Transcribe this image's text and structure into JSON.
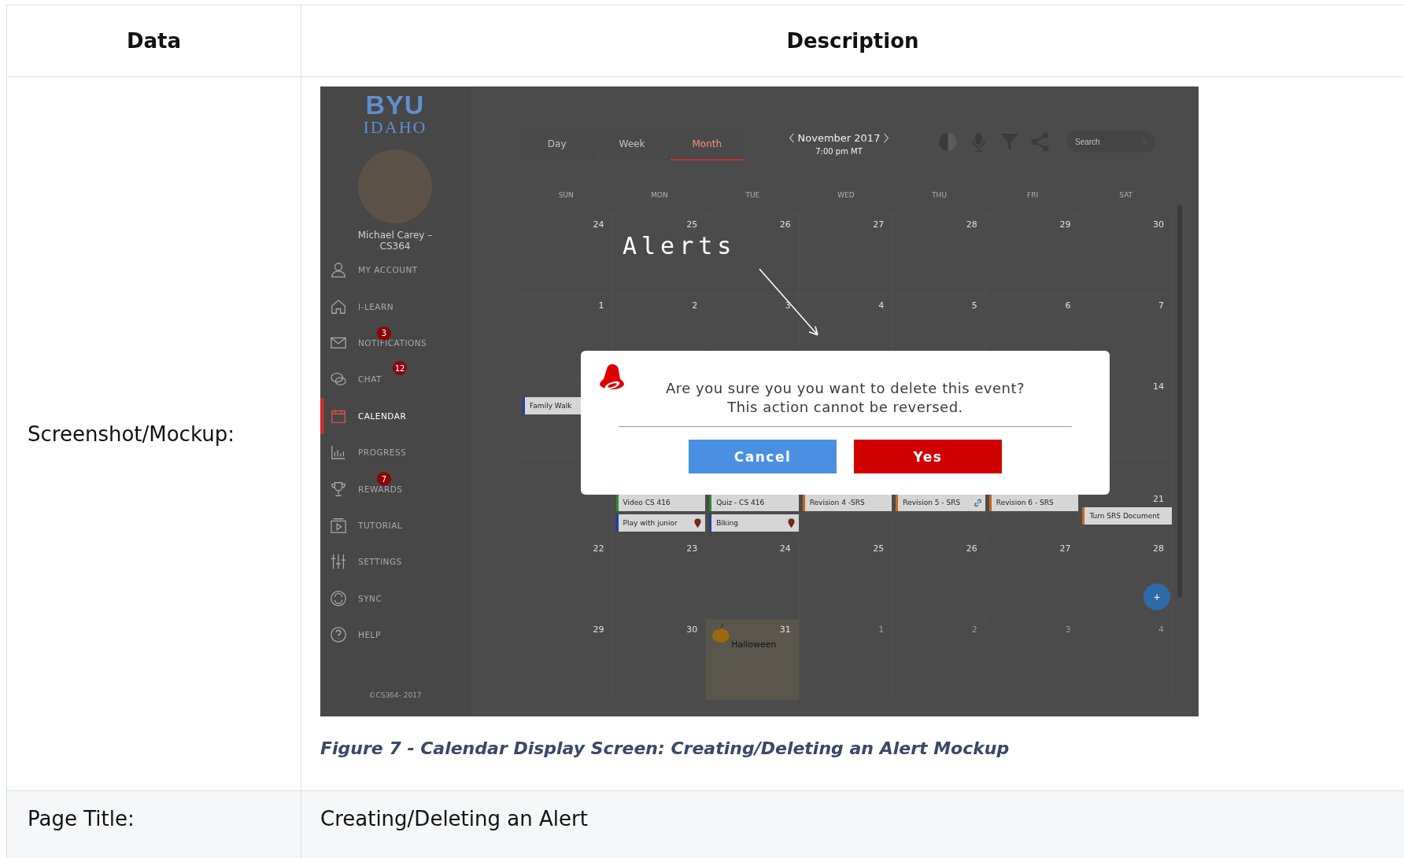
{
  "table": {
    "columns": [
      "Data",
      "Description"
    ],
    "mockup_row": {
      "label": "Screenshot/Mockup:",
      "caption": "Figure 7 - Calendar Display Screen: Creating/Deleting an Alert Mockup",
      "mockup": {
        "logo": {
          "line1": "BYU",
          "line2": "IDAHO"
        },
        "user_name": "Michael Carey – CS364",
        "nav": [
          {
            "kind": "account",
            "label": "MY ACCOUNT",
            "selected": false
          },
          {
            "kind": "home",
            "label": "I-LEARN",
            "selected": false
          },
          {
            "kind": "mail",
            "label": "NOTIFICATIONS",
            "selected": false,
            "badge": "3"
          },
          {
            "kind": "chat",
            "label": "CHAT",
            "selected": false,
            "badge": "12"
          },
          {
            "kind": "calendar",
            "label": "CALENDAR",
            "selected": true
          },
          {
            "kind": "chart",
            "label": "PROGRESS",
            "selected": false
          },
          {
            "kind": "trophy",
            "label": "REWARDS",
            "selected": false,
            "badge": "7"
          },
          {
            "kind": "play",
            "label": "TUTORIAL",
            "selected": false
          },
          {
            "kind": "sliders",
            "label": "SETTINGS",
            "selected": false
          },
          {
            "kind": "sync",
            "label": "SYNC",
            "selected": false
          },
          {
            "kind": "help",
            "label": "HELP",
            "selected": false
          }
        ],
        "footer": "©CS364- 2017",
        "view_tabs": [
          {
            "label": "Day",
            "selected": false
          },
          {
            "label": "Week",
            "selected": false
          },
          {
            "label": "Month",
            "selected": true
          }
        ],
        "month": "November 2017",
        "time": "7:00 pm MT",
        "search": {
          "placeholder": "Search"
        },
        "weekdays": [
          "SUN",
          "MON",
          "TUE",
          "WED",
          "THU",
          "FRI",
          "SAT"
        ],
        "weeks": [
          {
            "sun": {
              "day": "24"
            },
            "mon": {
              "day": "25"
            },
            "tue": {
              "day": "26"
            },
            "wed": {
              "day": "27"
            },
            "thu": {
              "day": "28"
            },
            "fri": {
              "day": "29"
            },
            "sat": {
              "day": "30"
            }
          },
          {
            "sun": {
              "day": "1"
            },
            "mon": {
              "day": "2"
            },
            "tue": {
              "day": "3"
            },
            "wed": {
              "day": "4"
            },
            "thu": {
              "day": "5"
            },
            "fri": {
              "day": "6"
            },
            "sat": {
              "day": "7"
            }
          },
          {
            "sun": {
              "events": [
                {
                  "title": "Family Walk",
                  "color": "#1f3f9e"
                }
              ]
            },
            "sat": {
              "day": "14"
            }
          },
          {
            "mon": {
              "events": [
                {
                  "title": "Video CS 416",
                  "color": "#2e8b2e"
                },
                {
                  "title": "Play with junior",
                  "color": "#1f3f9e",
                  "pin": true
                }
              ]
            },
            "tue": {
              "events": [
                {
                  "title": "Quiz - CS 416",
                  "color": "#2e8b2e"
                },
                {
                  "title": "Biking",
                  "color": "#1f3f9e",
                  "pin": true
                }
              ]
            },
            "wed": {
              "events": [
                {
                  "title": "Revision 4 -SRS",
                  "color": "#c8651d"
                }
              ]
            },
            "thu": {
              "events": [
                {
                  "title": "Revision 5 - SRS",
                  "color": "#c8651d",
                  "link": true
                }
              ]
            },
            "fri": {
              "events": [
                {
                  "title": "Revision 6 - SRS",
                  "color": "#c8651d"
                }
              ]
            },
            "sat": {
              "day": "21",
              "events": [
                {
                  "title": "Turn SRS Document",
                  "color": "#c8651d"
                }
              ]
            }
          },
          {
            "sun": {
              "day": "22"
            },
            "mon": {
              "day": "23"
            },
            "tue": {
              "day": "24"
            },
            "wed": {
              "day": "25"
            },
            "thu": {
              "day": "26"
            },
            "fri": {
              "day": "27"
            },
            "sat": {
              "day": "28"
            }
          },
          {
            "sun": {
              "day": "29"
            },
            "mon": {
              "day": "30"
            },
            "tue": {
              "day": "31",
              "holiday": "Halloween"
            },
            "wed": {
              "day": "1",
              "muted": true
            },
            "thu": {
              "day": "2",
              "muted": true
            },
            "fri": {
              "day": "3",
              "muted": true
            },
            "sat": {
              "day": "4",
              "muted": true
            }
          }
        ],
        "fab": "+",
        "annotation": "Alerts",
        "dialog": {
          "message": "Are you sure you you want to delete this event?",
          "note": "This action cannot be reversed.",
          "buttons": [
            {
              "kind": "cancel",
              "label": "Cancel"
            },
            {
              "kind": "confirm",
              "label": "Yes"
            }
          ]
        }
      }
    },
    "title_row": {
      "label": "Page Title:",
      "value": "Creating/Deleting an Alert"
    }
  }
}
